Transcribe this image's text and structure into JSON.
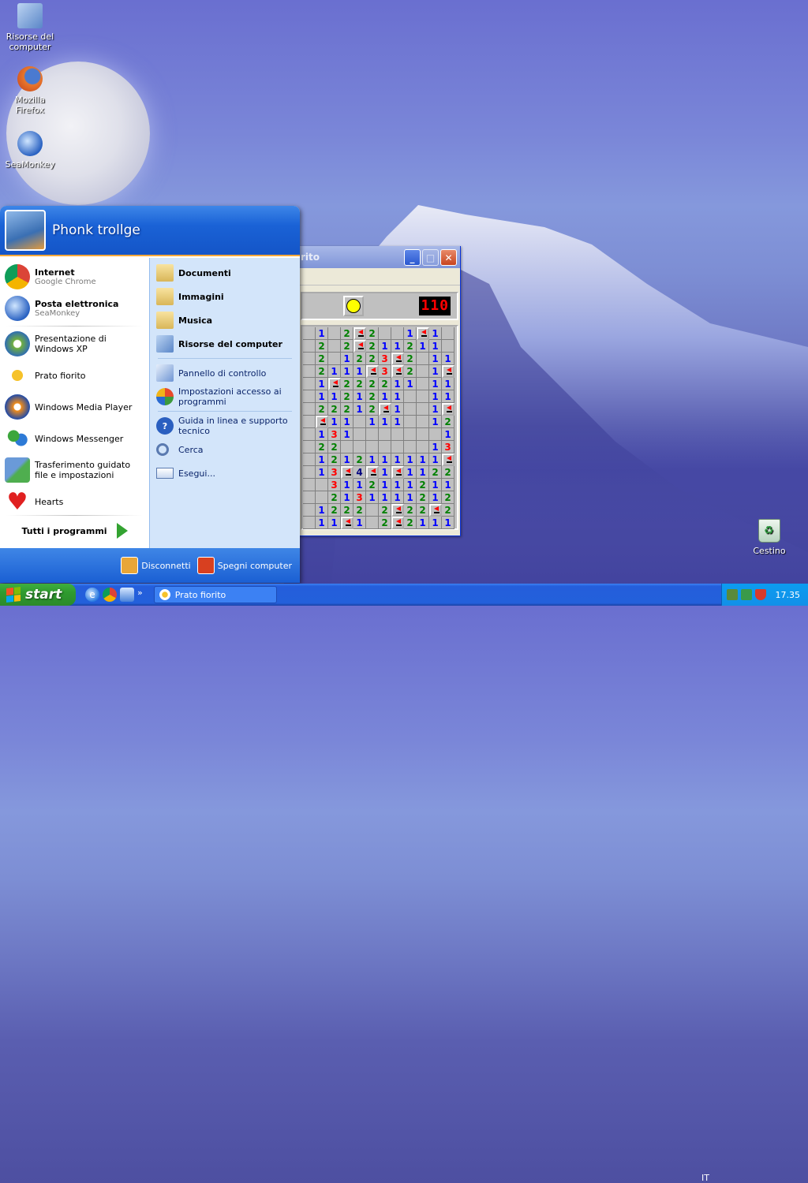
{
  "desktop": {
    "icons": [
      {
        "label": "Risorse del computer",
        "icon": "my-computer-icon"
      },
      {
        "label": "Mozilla Firefox",
        "icon": "firefox-icon"
      },
      {
        "label": "SeaMonkey",
        "icon": "seamonkey-icon"
      }
    ],
    "recycle_bin": {
      "label": "Cestino",
      "icon": "recycle-bin-icon"
    }
  },
  "start_menu": {
    "user": "Phonk trollge",
    "left": {
      "pinned": [
        {
          "title": "Internet",
          "subtitle": "Google Chrome",
          "icon": "chrome-icon"
        },
        {
          "title": "Posta elettronica",
          "subtitle": "SeaMonkey",
          "icon": "seamonkey-icon"
        }
      ],
      "recent": [
        {
          "label": "Presentazione di Windows XP",
          "icon": "tour-icon"
        },
        {
          "label": "Prato fiorito",
          "icon": "minesweeper-icon"
        },
        {
          "label": "Windows Media Player",
          "icon": "media-player-icon"
        },
        {
          "label": "Windows Messenger",
          "icon": "messenger-icon"
        },
        {
          "label": "Trasferimento guidato file e impostazioni",
          "icon": "transfer-wizard-icon"
        },
        {
          "label": "Hearts",
          "icon": "hearts-icon"
        }
      ],
      "all_programs": "Tutti i programmi"
    },
    "right": {
      "places": [
        {
          "label": "Documenti",
          "icon": "documents-folder-icon"
        },
        {
          "label": "Immagini",
          "icon": "pictures-folder-icon"
        },
        {
          "label": "Musica",
          "icon": "music-folder-icon"
        },
        {
          "label": "Risorse del computer",
          "icon": "my-computer-icon"
        }
      ],
      "system": [
        {
          "label": "Pannello di controllo",
          "icon": "control-panel-icon"
        },
        {
          "label": "Impostazioni accesso ai programmi",
          "icon": "program-access-icon"
        }
      ],
      "help": [
        {
          "label": "Guida in linea e supporto tecnico",
          "icon": "help-icon"
        },
        {
          "label": "Cerca",
          "icon": "search-icon"
        },
        {
          "label": "Esegui...",
          "icon": "run-icon"
        }
      ]
    },
    "footer": {
      "logoff": "Disconnetti",
      "shutdown": "Spegni computer"
    }
  },
  "minesweeper": {
    "title": "rito",
    "mine_counter": "110",
    "grid": [
      [
        "",
        "1",
        "",
        "2",
        "F",
        "2",
        "",
        "",
        "1",
        "F",
        "1",
        ""
      ],
      [
        "",
        "2",
        "",
        "2",
        "F",
        "2",
        "1",
        "1",
        "2",
        "1",
        "1",
        ""
      ],
      [
        "",
        "2",
        "",
        "1",
        "2",
        "2",
        "3",
        "F",
        "2",
        "",
        "1",
        "1"
      ],
      [
        "",
        "2",
        "1",
        "1",
        "1",
        "F",
        "3",
        "F",
        "2",
        "",
        "1",
        "F"
      ],
      [
        "",
        "1",
        "F",
        "2",
        "2",
        "2",
        "2",
        "1",
        "1",
        "",
        "1",
        "1"
      ],
      [
        "",
        "1",
        "1",
        "2",
        "1",
        "2",
        "1",
        "1",
        "",
        "",
        "1",
        "1"
      ],
      [
        "",
        "2",
        "2",
        "2",
        "1",
        "2",
        "F",
        "1",
        "",
        "",
        "1",
        "F"
      ],
      [
        "",
        "F",
        "1",
        "1",
        "",
        "1",
        "1",
        "1",
        "",
        "",
        "1",
        "2"
      ],
      [
        "",
        "1",
        "3",
        "1",
        "",
        "",
        "",
        "",
        "",
        "",
        "",
        "1"
      ],
      [
        "",
        "2",
        "2",
        "",
        "",
        "",
        "",
        "",
        "",
        "",
        "1",
        "3"
      ],
      [
        "",
        "1",
        "2",
        "1",
        "2",
        "1",
        "1",
        "1",
        "1",
        "1",
        "1",
        "F"
      ],
      [
        "",
        "1",
        "3",
        "F",
        "4",
        "F",
        "1",
        "F",
        "1",
        "1",
        "2",
        "2"
      ],
      [
        "",
        "",
        "3",
        "1",
        "1",
        "2",
        "1",
        "1",
        "1",
        "2",
        "1",
        "1"
      ],
      [
        "",
        "",
        "2",
        "1",
        "3",
        "1",
        "1",
        "1",
        "1",
        "2",
        "1",
        "2"
      ],
      [
        "",
        "1",
        "2",
        "2",
        "2",
        "",
        "2",
        "F",
        "2",
        "2",
        "F",
        "2"
      ],
      [
        "",
        "1",
        "1",
        "F",
        "1",
        "",
        "2",
        "F",
        "2",
        "1",
        "1",
        "1"
      ]
    ]
  },
  "taskbar": {
    "start_label": "start",
    "quick_launch": [
      "ie-icon",
      "chrome-icon",
      "messenger-icon"
    ],
    "overflow": "»",
    "task": {
      "label": "Prato fiorito",
      "icon": "minesweeper-icon"
    },
    "language": "IT",
    "clock": "17.35"
  },
  "colors": {
    "num1": "#0000ff",
    "num2": "#008000",
    "num3": "#ff0000",
    "num4": "#000080"
  }
}
